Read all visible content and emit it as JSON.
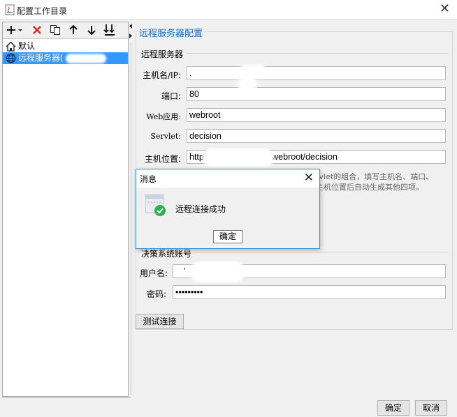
{
  "window": {
    "title": "配置工作目录",
    "close_glyph": "✕"
  },
  "toolbar": {
    "icons": [
      "add-icon",
      "delete-icon",
      "copy-icon",
      "move-up-icon",
      "move-down-icon",
      "move-bottom-icon"
    ]
  },
  "tree": {
    "items": [
      {
        "label": "默认",
        "icon": "home-icon"
      },
      {
        "label": "远程服务器(",
        "icon": "globe-icon",
        "selected": true
      }
    ]
  },
  "config": {
    "section_title": "远程服务器配置",
    "server_group_label": "远程服务器",
    "fields": {
      "host": {
        "label": "主机名/IP:",
        "value": "."
      },
      "port": {
        "label": "端口:",
        "value": "80"
      },
      "webapp": {
        "label": "Web应用:",
        "value": "webroot"
      },
      "servlet": {
        "label": "Servlet:",
        "value": "decision"
      },
      "location": {
        "label": "主机位置:",
        "value_prefix": "http://",
        "value_mid": "\"",
        "value_suffix": "0/webroot/decision"
      }
    },
    "hint_line1": "rvlet的组合，填写主机名、端口、",
    "hint_line2": "主机位置后自动生成其他四项。",
    "account_group_label": "决策系统账号",
    "account_fields": {
      "username": {
        "label": "用户名:",
        "value": "'"
      },
      "password": {
        "label": "密码:",
        "value": "•••••••••"
      }
    },
    "test_button": "测试连接"
  },
  "footer": {
    "ok_label": "确定",
    "cancel_label": "取消"
  },
  "dialog": {
    "title": "消息",
    "close_glyph": "✕",
    "message": "远程连接成功",
    "ok_label": "确定",
    "icon": "success-check-icon"
  },
  "colors": {
    "selection": "#3399ff",
    "section_title": "#1a70c2",
    "success": "#2bb24c"
  }
}
